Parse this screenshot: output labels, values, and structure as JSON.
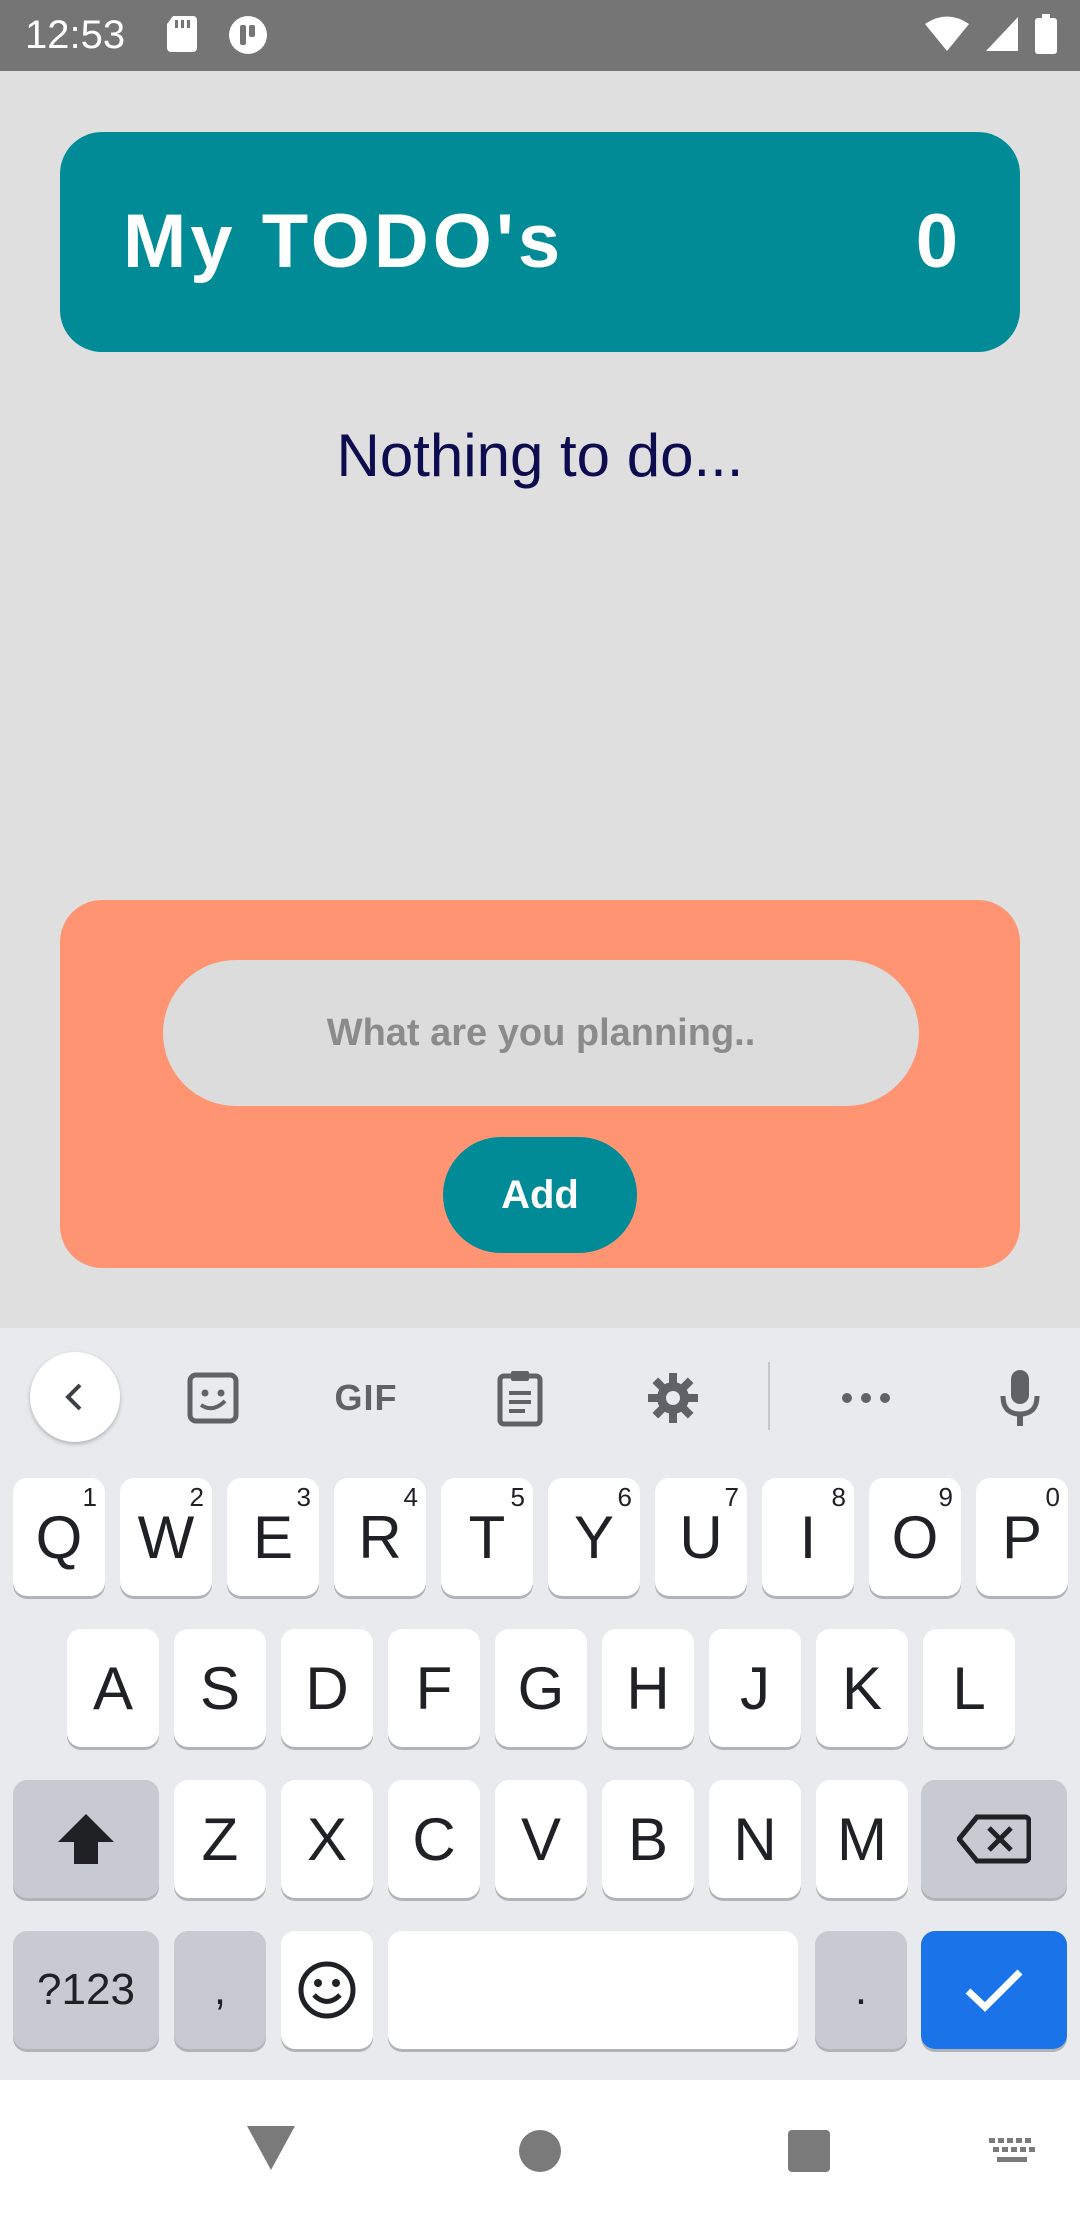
{
  "status_bar": {
    "time": "12:53",
    "icons": [
      "sd-card-icon",
      "app-notification-icon",
      "wifi-icon",
      "signal-icon",
      "battery-icon"
    ]
  },
  "header": {
    "title": "My TODO's",
    "count": "0"
  },
  "empty_state": {
    "message": "Nothing to do..."
  },
  "add_form": {
    "input_placeholder": "What are you planning..",
    "input_value": "",
    "add_label": "Add"
  },
  "keyboard": {
    "toolbar": {
      "gif_label": "GIF",
      "icons": [
        "back-chevron-icon",
        "sticker-icon",
        "gif-icon",
        "clipboard-icon",
        "settings-icon",
        "more-icon",
        "microphone-icon"
      ]
    },
    "row1": [
      {
        "key": "Q",
        "hint": "1"
      },
      {
        "key": "W",
        "hint": "2"
      },
      {
        "key": "E",
        "hint": "3"
      },
      {
        "key": "R",
        "hint": "4"
      },
      {
        "key": "T",
        "hint": "5"
      },
      {
        "key": "Y",
        "hint": "6"
      },
      {
        "key": "U",
        "hint": "7"
      },
      {
        "key": "I",
        "hint": "8"
      },
      {
        "key": "O",
        "hint": "9"
      },
      {
        "key": "P",
        "hint": "0"
      }
    ],
    "row2": [
      "A",
      "S",
      "D",
      "F",
      "G",
      "H",
      "J",
      "K",
      "L"
    ],
    "row3": [
      "Z",
      "X",
      "C",
      "V",
      "B",
      "N",
      "M"
    ],
    "symbols_label": "?123",
    "comma_label": ",",
    "period_label": "."
  },
  "colors": {
    "header_bg": "#008b96",
    "form_bg": "#ff9472",
    "empty_text": "#0d0c4f",
    "enter_key": "#1a73e8"
  }
}
